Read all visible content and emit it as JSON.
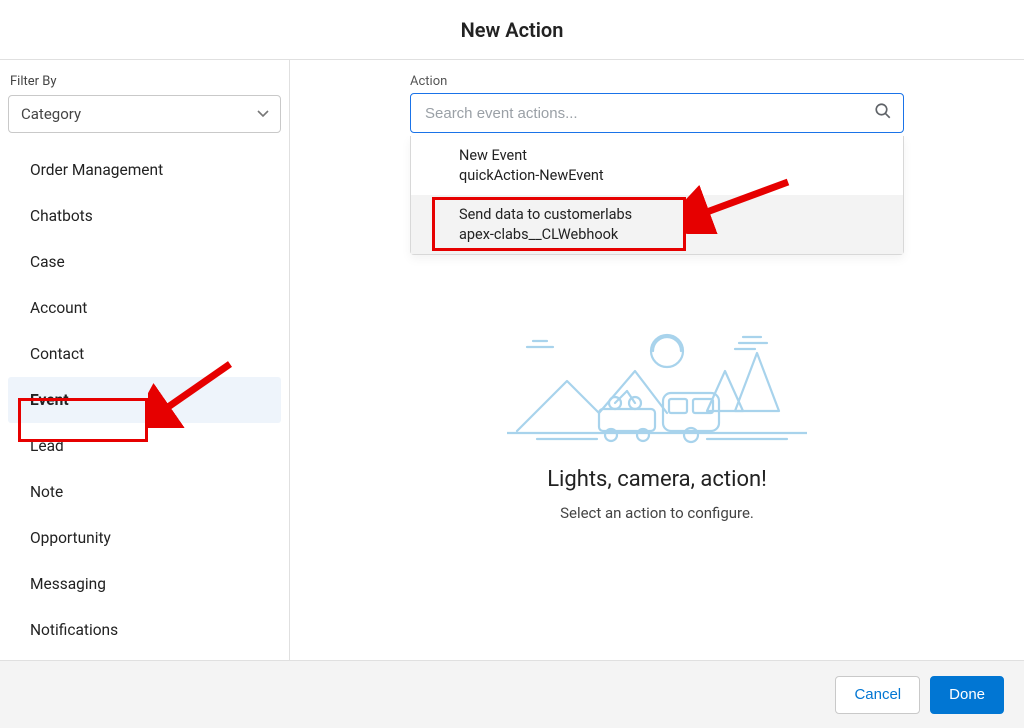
{
  "header": {
    "title": "New Action"
  },
  "sidebar": {
    "filter_label": "Filter By",
    "select_value": "Category",
    "items": [
      {
        "label": "Order Management",
        "selected": false
      },
      {
        "label": "Chatbots",
        "selected": false
      },
      {
        "label": "Case",
        "selected": false
      },
      {
        "label": "Account",
        "selected": false
      },
      {
        "label": "Contact",
        "selected": false
      },
      {
        "label": "Event",
        "selected": true
      },
      {
        "label": "Lead",
        "selected": false
      },
      {
        "label": "Note",
        "selected": false
      },
      {
        "label": "Opportunity",
        "selected": false
      },
      {
        "label": "Messaging",
        "selected": false
      },
      {
        "label": "Notifications",
        "selected": false
      }
    ]
  },
  "main": {
    "action_label": "Action",
    "search_placeholder": "Search event actions...",
    "dropdown": [
      {
        "title": "New Event",
        "sub": "quickAction-NewEvent",
        "hover": false
      },
      {
        "title": "Send data to customerlabs",
        "sub": "apex-clabs__CLWebhook",
        "hover": true
      }
    ],
    "empty": {
      "title": "Lights, camera, action!",
      "sub": "Select an action to configure."
    }
  },
  "footer": {
    "cancel": "Cancel",
    "done": "Done"
  }
}
